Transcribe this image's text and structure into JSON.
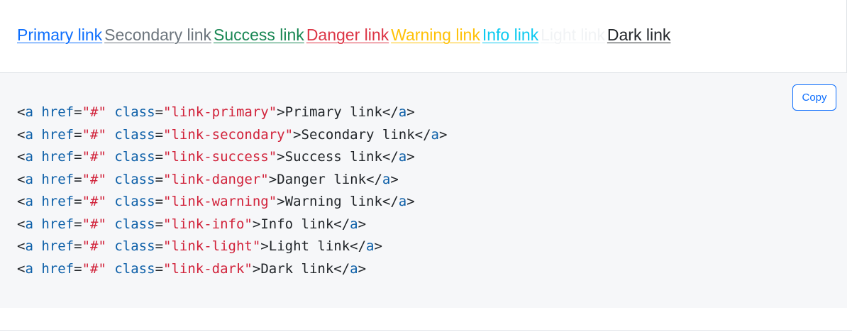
{
  "links": [
    {
      "text": "Primary link",
      "color": "#0d6efd"
    },
    {
      "text": "Secondary link",
      "color": "#6c757d"
    },
    {
      "text": "Success link",
      "color": "#198754"
    },
    {
      "text": "Danger link",
      "color": "#dc3545"
    },
    {
      "text": "Warning link",
      "color": "#ffc107"
    },
    {
      "text": "Info link",
      "color": "#0dcaf0"
    },
    {
      "text": "Light link",
      "color": "#f1f3f5"
    },
    {
      "text": "Dark link",
      "color": "#212529"
    }
  ],
  "copy_button": {
    "label": "Copy"
  },
  "code_lines": [
    {
      "open": "<",
      "tag": "a",
      "attr1": "href",
      "eq1": "=",
      "val1": "\"#\"",
      "attr2": "class",
      "eq2": "=",
      "val2": "\"link-primary\"",
      "gt": ">",
      "text": "Primary link",
      "close_open": "</",
      "close_tag": "a",
      "close_gt": ">"
    },
    {
      "open": "<",
      "tag": "a",
      "attr1": "href",
      "eq1": "=",
      "val1": "\"#\"",
      "attr2": "class",
      "eq2": "=",
      "val2": "\"link-secondary\"",
      "gt": ">",
      "text": "Secondary link",
      "close_open": "</",
      "close_tag": "a",
      "close_gt": ">"
    },
    {
      "open": "<",
      "tag": "a",
      "attr1": "href",
      "eq1": "=",
      "val1": "\"#\"",
      "attr2": "class",
      "eq2": "=",
      "val2": "\"link-success\"",
      "gt": ">",
      "text": "Success link",
      "close_open": "</",
      "close_tag": "a",
      "close_gt": ">"
    },
    {
      "open": "<",
      "tag": "a",
      "attr1": "href",
      "eq1": "=",
      "val1": "\"#\"",
      "attr2": "class",
      "eq2": "=",
      "val2": "\"link-danger\"",
      "gt": ">",
      "text": "Danger link",
      "close_open": "</",
      "close_tag": "a",
      "close_gt": ">"
    },
    {
      "open": "<",
      "tag": "a",
      "attr1": "href",
      "eq1": "=",
      "val1": "\"#\"",
      "attr2": "class",
      "eq2": "=",
      "val2": "\"link-warning\"",
      "gt": ">",
      "text": "Warning link",
      "close_open": "</",
      "close_tag": "a",
      "close_gt": ">"
    },
    {
      "open": "<",
      "tag": "a",
      "attr1": "href",
      "eq1": "=",
      "val1": "\"#\"",
      "attr2": "class",
      "eq2": "=",
      "val2": "\"link-info\"",
      "gt": ">",
      "text": "Info link",
      "close_open": "</",
      "close_tag": "a",
      "close_gt": ">"
    },
    {
      "open": "<",
      "tag": "a",
      "attr1": "href",
      "eq1": "=",
      "val1": "\"#\"",
      "attr2": "class",
      "eq2": "=",
      "val2": "\"link-light\"",
      "gt": ">",
      "text": "Light link",
      "close_open": "</",
      "close_tag": "a",
      "close_gt": ">"
    },
    {
      "open": "<",
      "tag": "a",
      "attr1": "href",
      "eq1": "=",
      "val1": "\"#\"",
      "attr2": "class",
      "eq2": "=",
      "val2": "\"link-dark\"",
      "gt": ">",
      "text": "Dark link",
      "close_open": "</",
      "close_tag": "a",
      "close_gt": ">"
    }
  ]
}
